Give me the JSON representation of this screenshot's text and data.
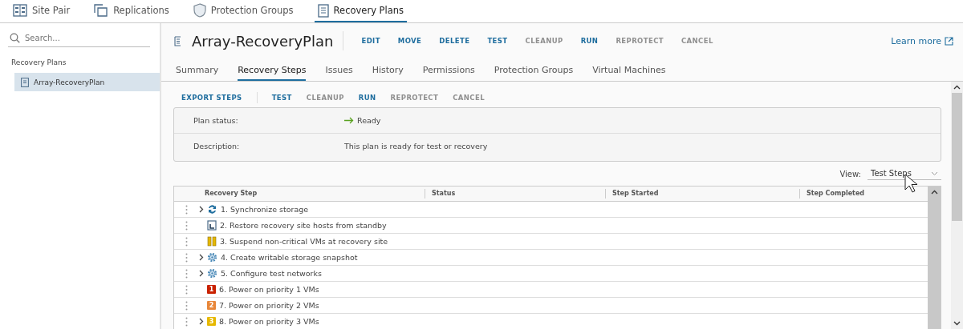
{
  "top_tabs": [
    {
      "label": "Site Pair",
      "selected": false
    },
    {
      "label": "Replications",
      "selected": false
    },
    {
      "label": "Protection Groups",
      "selected": false
    },
    {
      "label": "Recovery Plans",
      "selected": true
    }
  ],
  "sidebar": {
    "search": {
      "placeholder": "Search..."
    },
    "heading": "Recovery Plans",
    "items": [
      {
        "label": "Array-RecoveryPlan",
        "selected": true
      }
    ]
  },
  "header": {
    "title": "Array-RecoveryPlan",
    "actions": [
      {
        "label": "EDIT",
        "disabled": false
      },
      {
        "label": "MOVE",
        "disabled": false
      },
      {
        "label": "DELETE",
        "disabled": false
      },
      {
        "label": "TEST",
        "disabled": false
      },
      {
        "label": "CLEANUP",
        "disabled": true
      },
      {
        "label": "RUN",
        "disabled": false
      },
      {
        "label": "REPROTECT",
        "disabled": true
      },
      {
        "label": "CANCEL",
        "disabled": true
      }
    ],
    "learn_more": "Learn more"
  },
  "tabs": [
    {
      "label": "Summary",
      "selected": false
    },
    {
      "label": "Recovery Steps",
      "selected": true
    },
    {
      "label": "Issues",
      "selected": false
    },
    {
      "label": "History",
      "selected": false
    },
    {
      "label": "Permissions",
      "selected": false
    },
    {
      "label": "Protection Groups",
      "selected": false
    },
    {
      "label": "Virtual Machines",
      "selected": false
    }
  ],
  "toolbar": {
    "export": "EXPORT STEPS",
    "actions": [
      {
        "label": "TEST",
        "disabled": false
      },
      {
        "label": "CLEANUP",
        "disabled": true
      },
      {
        "label": "RUN",
        "disabled": false
      },
      {
        "label": "REPROTECT",
        "disabled": true
      },
      {
        "label": "CANCEL",
        "disabled": true
      }
    ]
  },
  "info": {
    "status_label": "Plan status:",
    "status": "Ready",
    "description_label": "Description:",
    "description": "This plan is ready for test or recovery"
  },
  "view": {
    "label": "View:",
    "value": "Test Steps"
  },
  "table": {
    "columns": [
      "Recovery Step",
      "Status",
      "Step Started",
      "Step Completed"
    ],
    "rows": [
      {
        "step": "1. Synchronize storage",
        "kind": "sync",
        "expandable": true
      },
      {
        "step": "2. Restore recovery site hosts from standby",
        "kind": "host",
        "expandable": false
      },
      {
        "step": "3. Suspend non-critical VMs at recovery site",
        "kind": "suspend",
        "expandable": false
      },
      {
        "step": "4. Create writable storage snapshot",
        "kind": "gear",
        "expandable": true
      },
      {
        "step": "5. Configure test networks",
        "kind": "gear",
        "expandable": true
      },
      {
        "step": "6. Power on priority 1 VMs",
        "kind": "priority",
        "badge": "1",
        "color": "#c92100",
        "expandable": false
      },
      {
        "step": "7. Power on priority 2 VMs",
        "kind": "priority",
        "badge": "2",
        "color": "#e8873a",
        "expandable": false
      },
      {
        "step": "8. Power on priority 3 VMs",
        "kind": "priority",
        "badge": "3",
        "color": "#e6b800",
        "expandable": true
      }
    ]
  }
}
